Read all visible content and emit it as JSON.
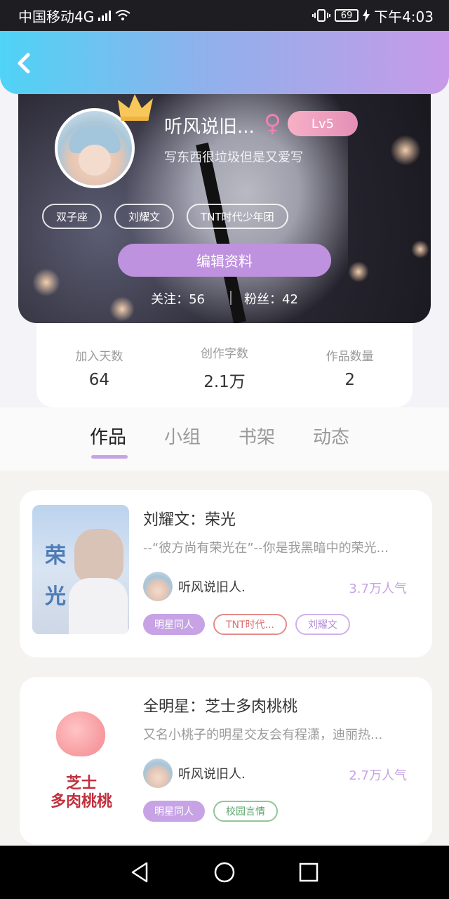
{
  "status_bar": {
    "carrier": "中国移动4G",
    "network": "4G",
    "battery": "69",
    "time": "下午4:03"
  },
  "profile": {
    "name": "听风说旧...",
    "gender_symbol": "♀",
    "level": "Lv5",
    "signature": "写东西很垃圾但是又爱写",
    "tags": [
      "双子座",
      "刘耀文",
      "TNT时代少年团"
    ],
    "edit_button": "编辑资料",
    "following_label": "关注：",
    "following": "56",
    "fans_label": "粉丝：",
    "fans": "42"
  },
  "stats": [
    {
      "label": "加入天数",
      "value": "64"
    },
    {
      "label": "创作字数",
      "value": "2.1万"
    },
    {
      "label": "作品数量",
      "value": "2"
    }
  ],
  "tabs": [
    "作品",
    "小组",
    "书架",
    "动态"
  ],
  "active_tab": "作品",
  "works": [
    {
      "title": "刘耀文：荣光",
      "desc": "--“彼方尚有荣光在”--你是我黑暗中的荣光...",
      "author": "听风说旧人.",
      "popularity": "3.7万人气",
      "cover_text": "荣光",
      "tags": [
        "明星同人",
        "TNT时代...",
        "刘耀文"
      ]
    },
    {
      "title": "全明星：芝士多肉桃桃",
      "desc": "又名小桃子的明星交友会有程潇，迪丽热...",
      "author": "听风说旧人.",
      "popularity": "2.7万人气",
      "cover_text": "芝士多肉桃桃",
      "tags": [
        "明星同人",
        "校园言情"
      ]
    }
  ],
  "colors": {
    "accent": "#c7a3e6",
    "header_start": "#4fd3f6",
    "header_end": "#c79ae8",
    "female": "#f37fb5"
  },
  "icons": {
    "back": "chevron-left-icon",
    "nav": [
      "back-triangle-icon",
      "home-circle-icon",
      "recent-square-icon"
    ]
  }
}
